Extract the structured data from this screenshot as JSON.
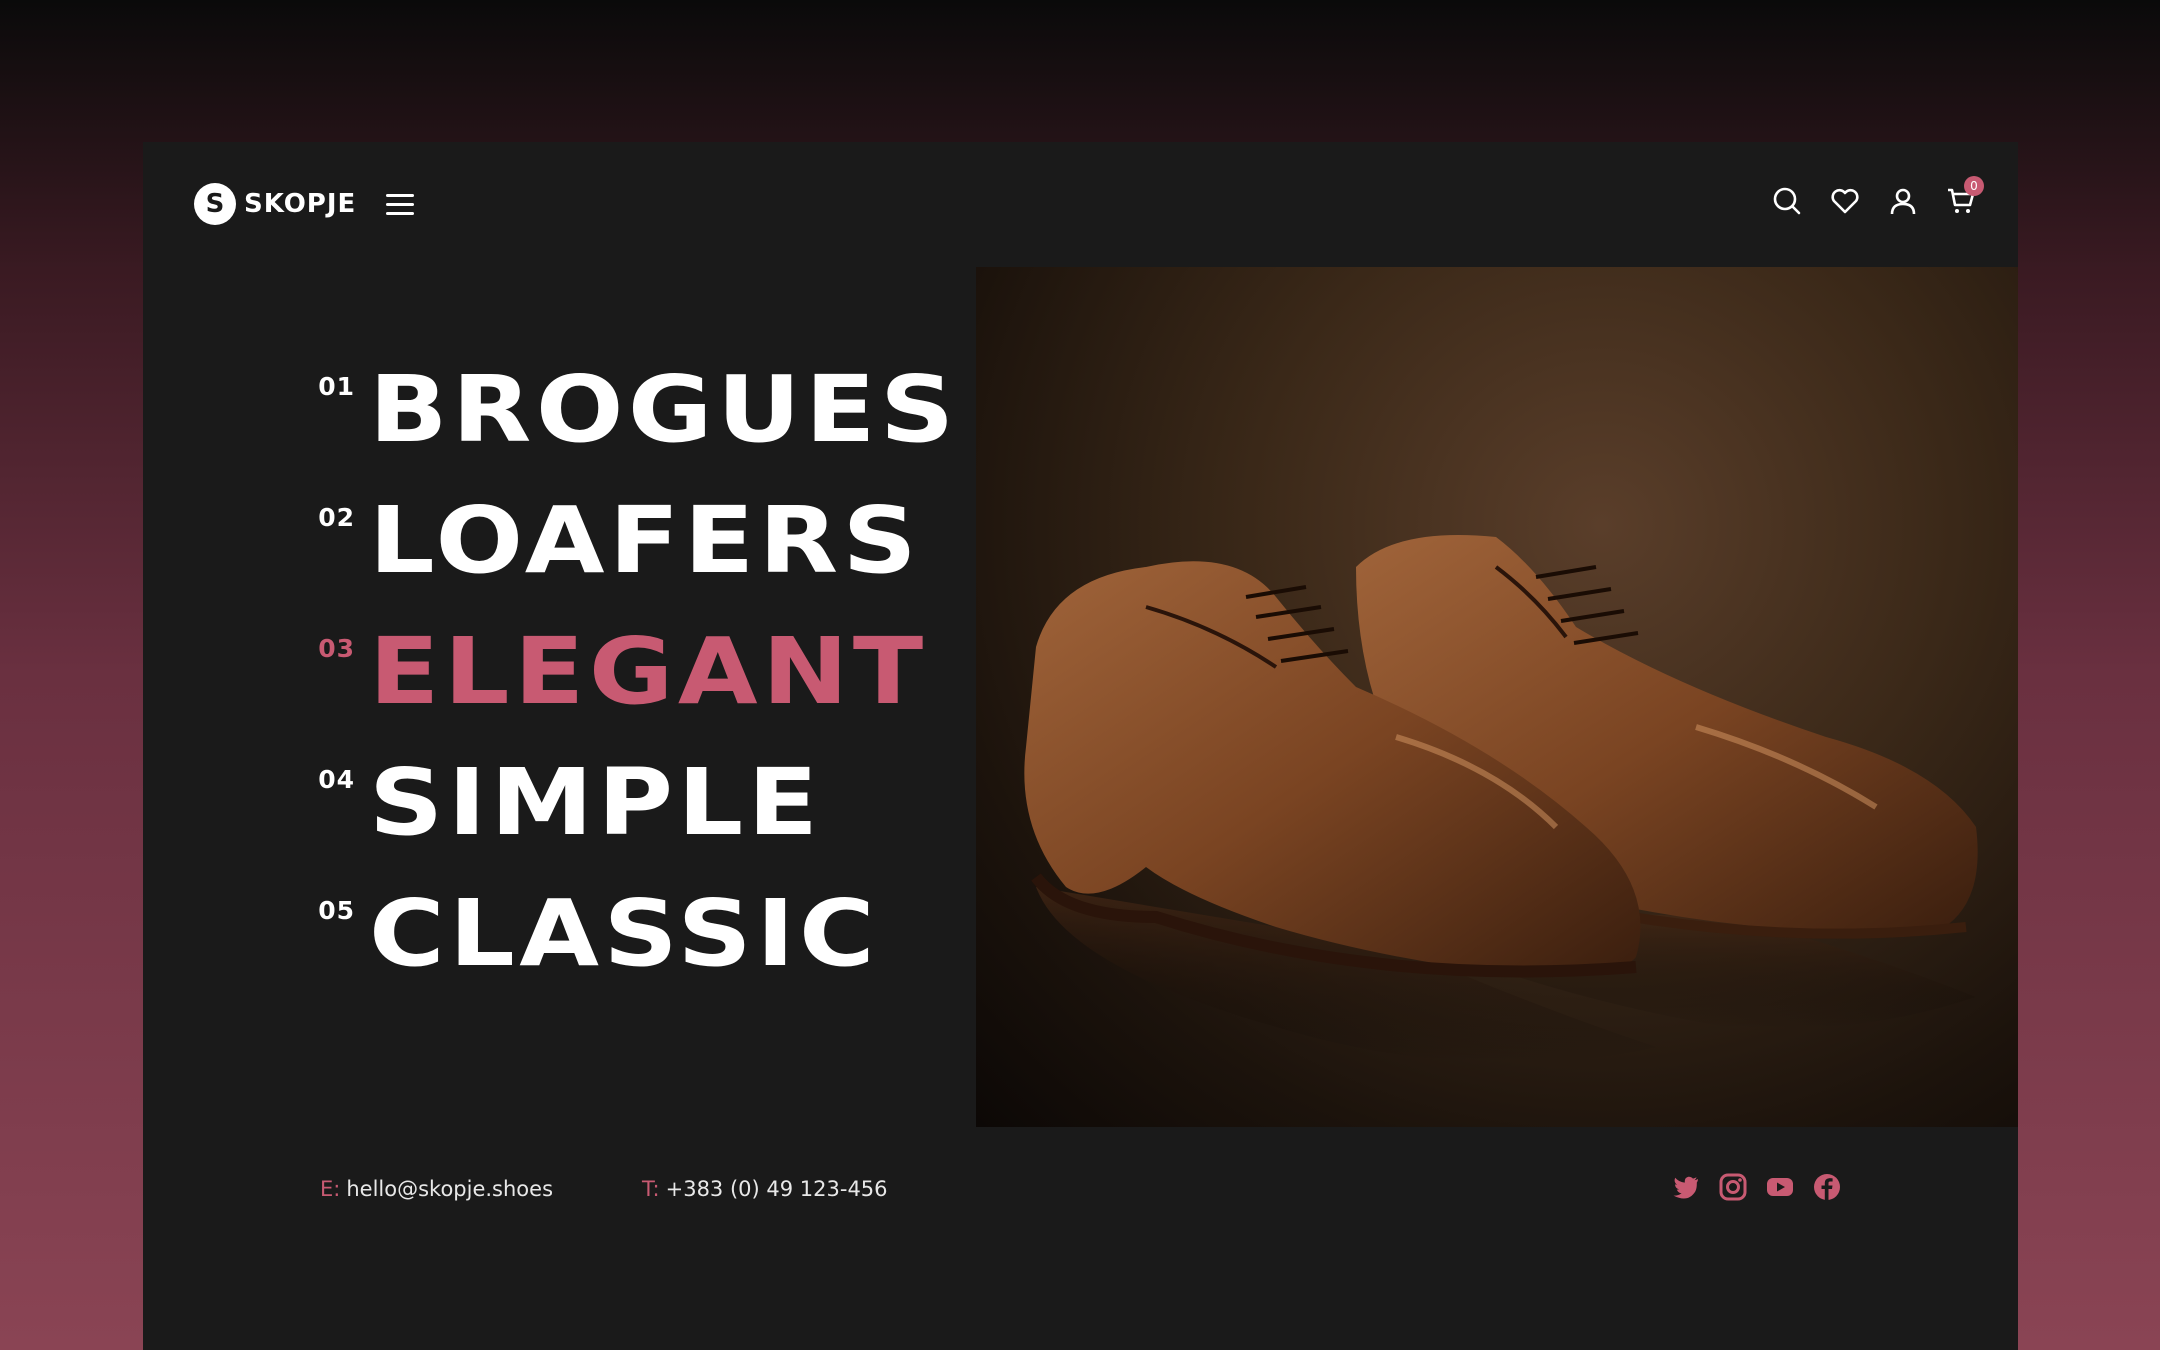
{
  "brand": {
    "mark": "S",
    "name": "SKOPJE"
  },
  "header": {
    "icons": [
      "search-icon",
      "heart-icon",
      "user-icon",
      "cart-icon"
    ],
    "cart_count": "0"
  },
  "categories": [
    {
      "num": "01",
      "label": "BROGUES",
      "active": false
    },
    {
      "num": "02",
      "label": "LOAFERS",
      "active": false
    },
    {
      "num": "03",
      "label": "ELEGANT",
      "active": true
    },
    {
      "num": "04",
      "label": "SIMPLE",
      "active": false
    },
    {
      "num": "05",
      "label": "CLASSIC",
      "active": false
    }
  ],
  "contact": {
    "email_key": "E:",
    "email": "hello@skopje.shoes",
    "phone_key": "T:",
    "phone": "+383 (0) 49 123-456"
  },
  "social": [
    "twitter-icon",
    "instagram-icon",
    "youtube-icon",
    "facebook-icon"
  ],
  "colors": {
    "accent": "#c85a72",
    "panel": "#1a1a1a"
  }
}
